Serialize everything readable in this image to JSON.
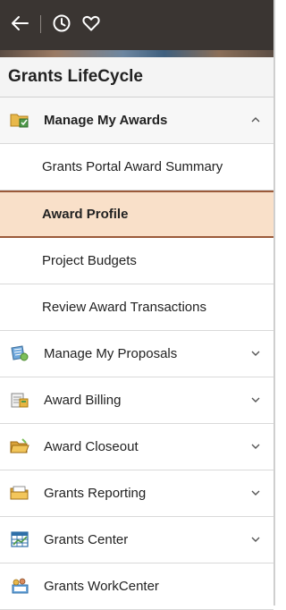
{
  "header": {
    "back_icon": "back-arrow-icon",
    "history_icon": "clock-icon",
    "favorites_icon": "heart-icon"
  },
  "section": {
    "title": "Grants LifeCycle"
  },
  "menu": {
    "expanded": {
      "label": "Manage My Awards",
      "icon": "awards-folder-icon",
      "subitems": [
        {
          "label": "Grants Portal Award Summary"
        },
        {
          "label": "Award Profile",
          "active": true
        },
        {
          "label": "Project Budgets"
        },
        {
          "label": "Review Award Transactions"
        }
      ]
    },
    "items": [
      {
        "label": "Manage My Proposals",
        "icon": "proposals-icon"
      },
      {
        "label": "Award Billing",
        "icon": "billing-icon"
      },
      {
        "label": "Award Closeout",
        "icon": "closeout-folder-icon"
      },
      {
        "label": "Grants Reporting",
        "icon": "reporting-folder-icon"
      },
      {
        "label": "Grants Center",
        "icon": "grid-chart-icon"
      },
      {
        "label": "Grants WorkCenter",
        "icon": "workcenter-icon"
      }
    ]
  },
  "colors": {
    "topbar": "#3a3532",
    "active_bg": "#f9e0c9",
    "active_border": "#9b5a3a"
  }
}
